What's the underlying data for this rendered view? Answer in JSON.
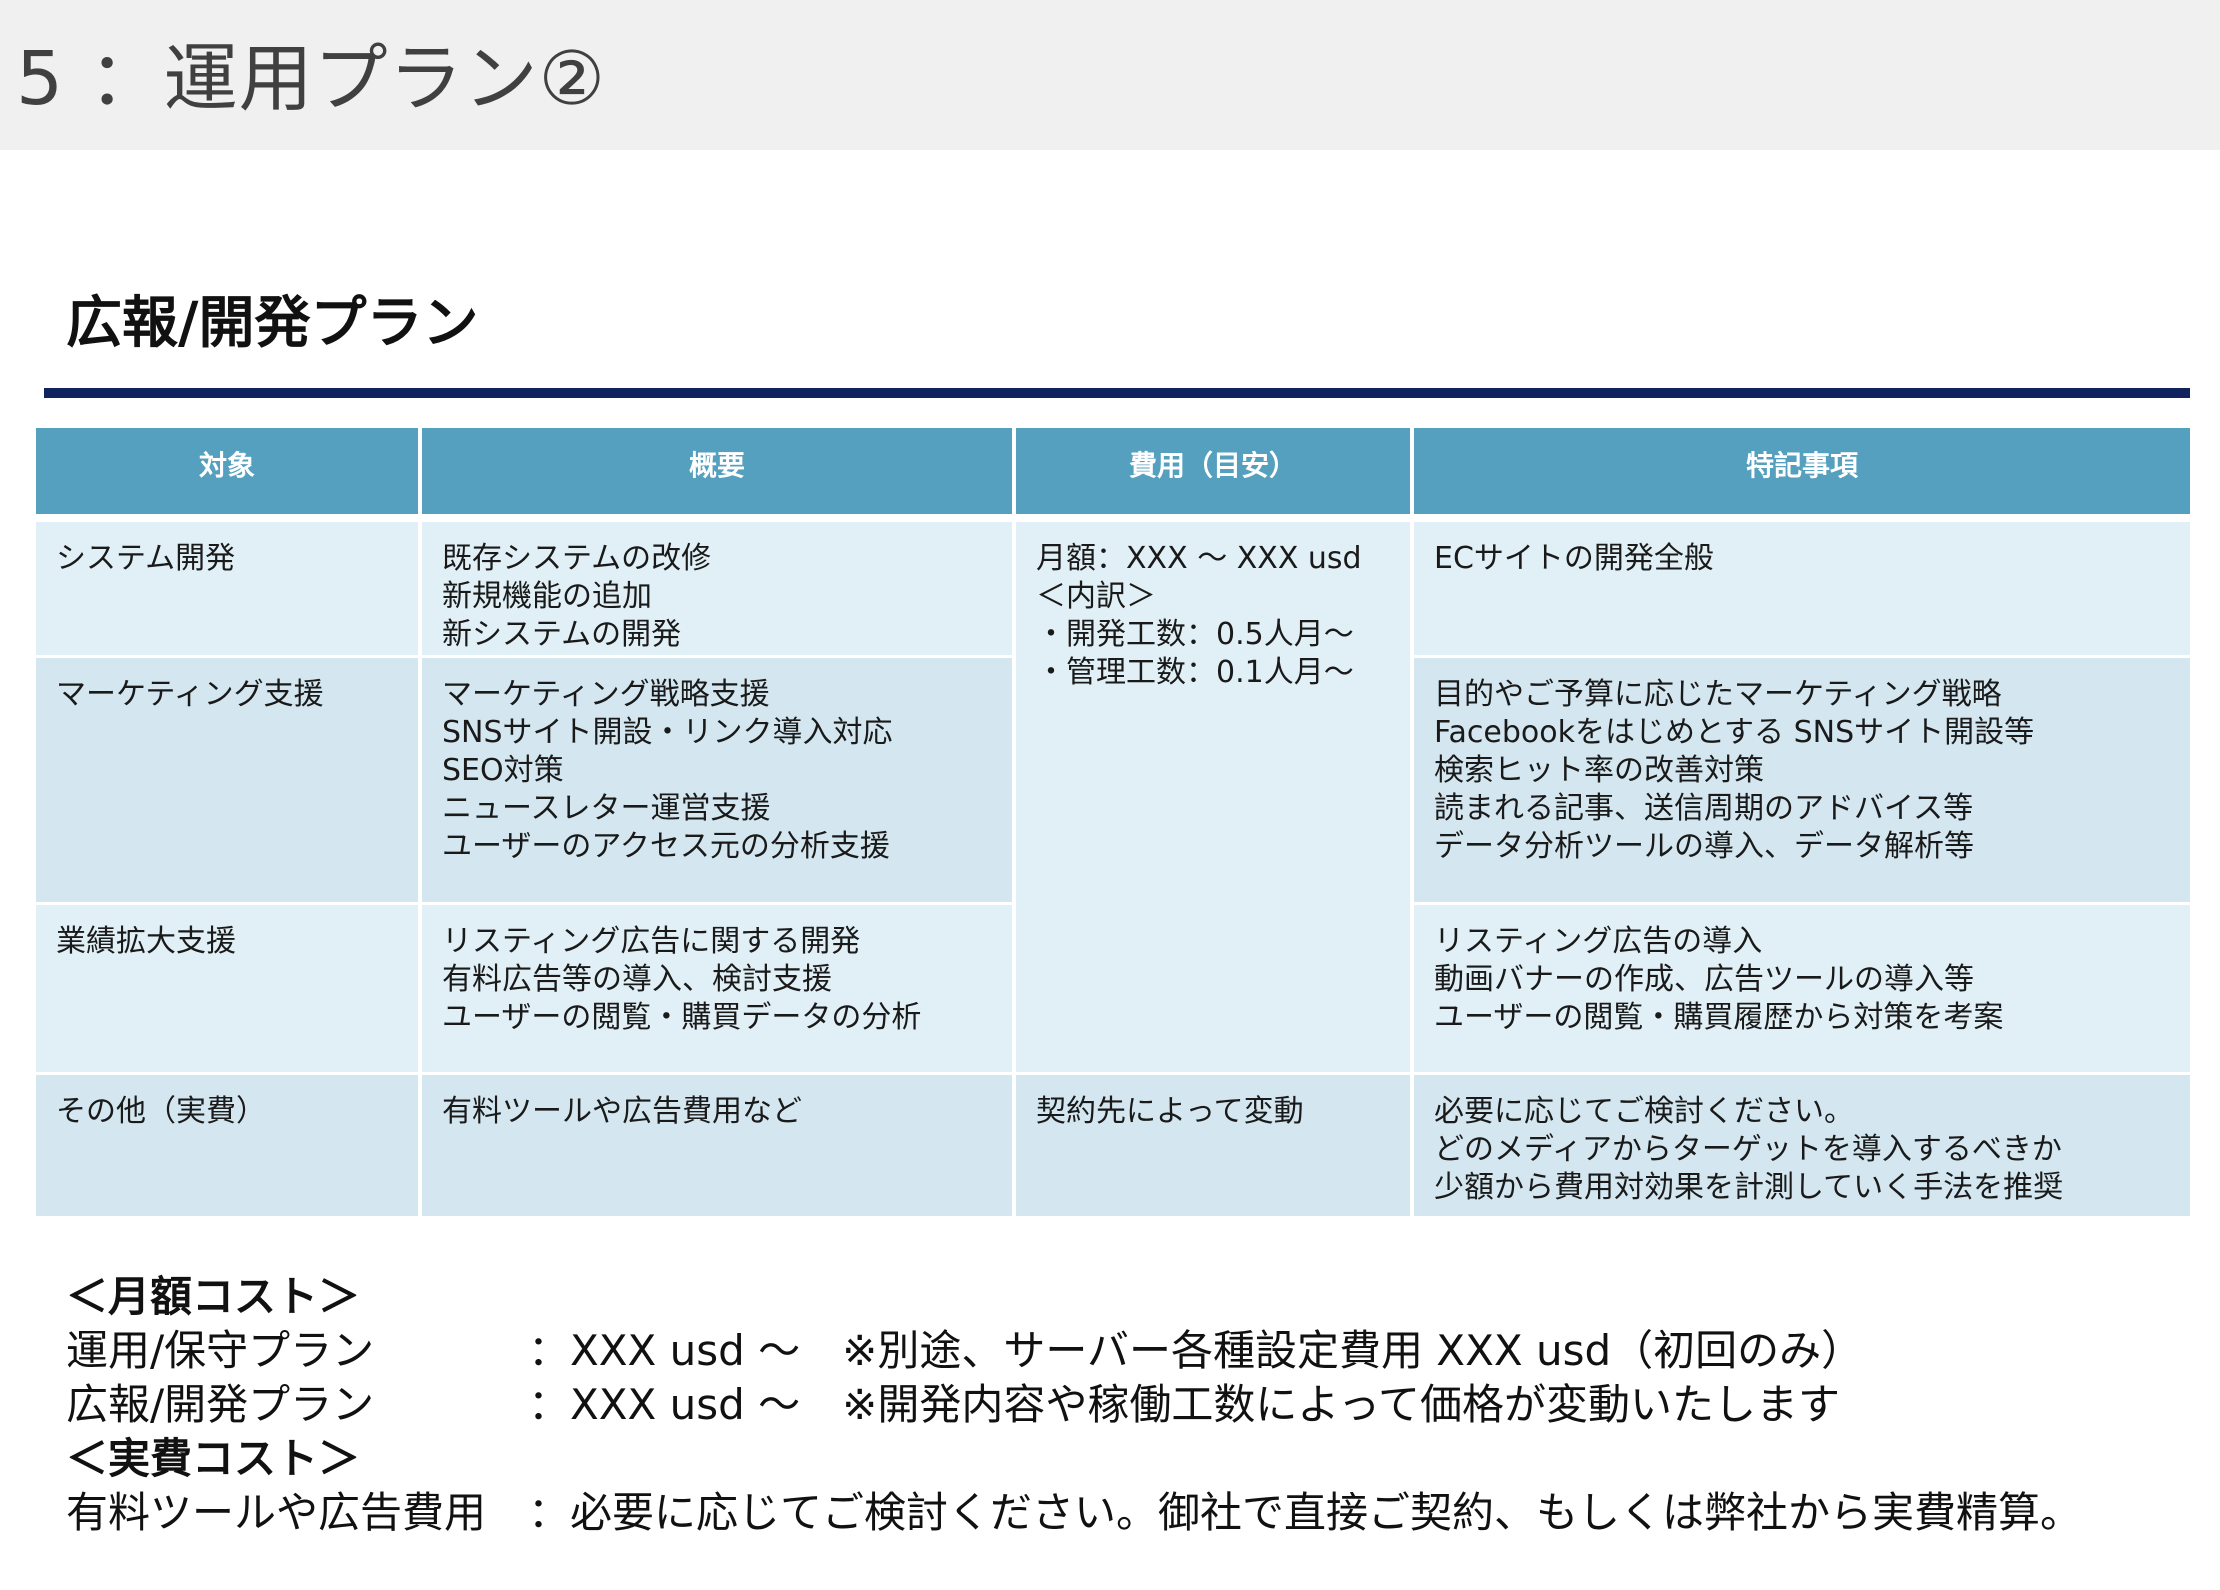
{
  "slide_title": "5 ：運用プラン②",
  "section_title": "広報/開発プラン",
  "table": {
    "headers": [
      "対象",
      "概要",
      "費用（目安）",
      "特記事項"
    ],
    "rows": [
      {
        "target": "システム開発",
        "summary": [
          "既存システムの改修",
          "新規機能の追加",
          "新システムの開発"
        ],
        "notes": [
          "ECサイトの開発全般"
        ]
      },
      {
        "target": "マーケティング支援",
        "summary": [
          "マーケティング戦略支援",
          "SNSサイト開設・リンク導入対応",
          "SEO対策",
          "ニュースレター運営支援",
          "ユーザーのアクセス元の分析支援"
        ],
        "notes": [
          "目的やご予算に応じたマーケティング戦略",
          "Facebookをはじめとする SNSサイト開設等",
          "検索ヒット率の改善対策",
          "読まれる記事、送信周期のアドバイス等",
          "データ分析ツールの導入、データ解析等"
        ]
      },
      {
        "target": "業績拡大支援",
        "summary": [
          "リスティング広告に関する開発",
          "有料広告等の導入、検討支援",
          "ユーザーの閲覧・購買データの分析"
        ],
        "notes": [
          "リスティング広告の導入",
          "動画バナーの作成、広告ツールの導入等",
          "ユーザーの閲覧・購買履歴から対策を考案"
        ]
      },
      {
        "target": "その他（実費）",
        "summary": [
          "有料ツールや広告費用など"
        ],
        "cost": [
          "契約先によって変動"
        ],
        "notes": [
          "必要に応じてご検討ください。",
          "どのメディアからターゲットを導入するべきか",
          "少額から費用対効果を計測していく手法を推奨"
        ]
      }
    ],
    "shared_cost": [
      "月額：XXX 〜 XXX usd",
      "＜内訳＞",
      "・開発工数：0.5人月〜",
      "・管理工数：0.1人月〜"
    ]
  },
  "footer": {
    "monthly_heading": "＜月額コスト＞",
    "monthly_items": [
      {
        "label": "運用/保守プラン",
        "value": "：XXX usd 〜　※別途、サーバー各種設定費用 XXX usd（初回のみ）"
      },
      {
        "label": "広報/開発プラン",
        "value": "：XXX usd 〜　※開発内容や稼働工数によって価格が変動いたします"
      }
    ],
    "actual_heading": "＜実費コスト＞",
    "actual_items": [
      {
        "label": "有料ツールや広告費用",
        "value": "：必要に応じてご検討ください。御社で直接ご契約、もしくは弊社から実費精算。"
      }
    ]
  },
  "colors": {
    "header_band": "#f0f0f0",
    "rule": "#10235e",
    "table_header": "#559fbf",
    "row_light": "#e1f0f6",
    "row_dark": "#d4e7f0"
  }
}
